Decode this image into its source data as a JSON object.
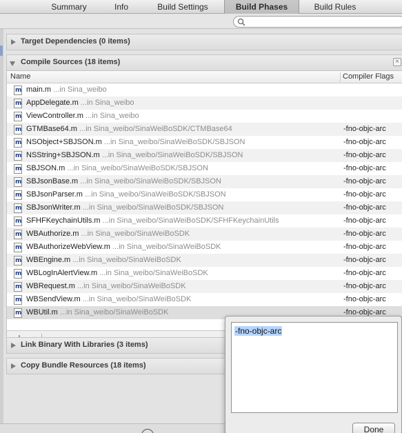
{
  "tabs": [
    {
      "label": "Summary"
    },
    {
      "label": "Info"
    },
    {
      "label": "Build Settings"
    },
    {
      "label": "Build Phases"
    },
    {
      "label": "Build Rules"
    }
  ],
  "active_tab": "Build Phases",
  "phases": {
    "target_dependencies": "Target Dependencies (0 items)",
    "compile_sources": "Compile Sources (18 items)",
    "link_binary": "Link Binary With Libraries (3 items)",
    "copy_bundle": "Copy Bundle Resources (18 items)"
  },
  "columns": {
    "name": "Name",
    "flags": "Compiler Flags"
  },
  "files": [
    {
      "name": "main.m",
      "path": " ...in Sina_weibo",
      "flag": ""
    },
    {
      "name": "AppDelegate.m",
      "path": " ...in Sina_weibo",
      "flag": ""
    },
    {
      "name": "ViewController.m",
      "path": " ...in Sina_weibo",
      "flag": ""
    },
    {
      "name": "GTMBase64.m",
      "path": " ...in Sina_weibo/SinaWeiBoSDK/CTMBase64",
      "flag": "-fno-objc-arc"
    },
    {
      "name": "NSObject+SBJSON.m",
      "path": " ...in Sina_weibo/SinaWeiBoSDK/SBJSON",
      "flag": "-fno-objc-arc"
    },
    {
      "name": "NSString+SBJSON.m",
      "path": " ...in Sina_weibo/SinaWeiBoSDK/SBJSON",
      "flag": "-fno-objc-arc"
    },
    {
      "name": "SBJSON.m",
      "path": " ...in Sina_weibo/SinaWeiBoSDK/SBJSON",
      "flag": "-fno-objc-arc"
    },
    {
      "name": "SBJsonBase.m",
      "path": " ...in Sina_weibo/SinaWeiBoSDK/SBJSON",
      "flag": "-fno-objc-arc"
    },
    {
      "name": "SBJsonParser.m",
      "path": " ...in Sina_weibo/SinaWeiBoSDK/SBJSON",
      "flag": "-fno-objc-arc"
    },
    {
      "name": "SBJsonWriter.m",
      "path": " ...in Sina_weibo/SinaWeiBoSDK/SBJSON",
      "flag": "-fno-objc-arc"
    },
    {
      "name": "SFHFKeychainUtils.m",
      "path": " ...in Sina_weibo/SinaWeiBoSDK/SFHFKeychainUtils",
      "flag": "-fno-objc-arc"
    },
    {
      "name": "WBAuthorize.m",
      "path": " ...in Sina_weibo/SinaWeiBoSDK",
      "flag": "-fno-objc-arc"
    },
    {
      "name": "WBAuthorizeWebView.m",
      "path": " ...in Sina_weibo/SinaWeiBoSDK",
      "flag": "-fno-objc-arc"
    },
    {
      "name": "WBEngine.m",
      "path": " ...in Sina_weibo/SinaWeiBoSDK",
      "flag": "-fno-objc-arc"
    },
    {
      "name": "WBLogInAlertView.m",
      "path": " ...in Sina_weibo/SinaWeiBoSDK",
      "flag": "-fno-objc-arc"
    },
    {
      "name": "WBRequest.m",
      "path": " ...in Sina_weibo/SinaWeiBoSDK",
      "flag": "-fno-objc-arc"
    },
    {
      "name": "WBSendView.m",
      "path": " ...in Sina_weibo/SinaWeiBoSDK",
      "flag": "-fno-objc-arc"
    },
    {
      "name": "WBUtil.m",
      "path": " ...in Sina_weibo/SinaWeiBoSDK",
      "flag": "-fno-objc-arc"
    }
  ],
  "selected_file": "WBUtil.m",
  "add_bar": {
    "add": "+",
    "remove": "−"
  },
  "editor": {
    "value": "-fno-objc-arc",
    "done_label": "Done"
  },
  "icons": {
    "file": "objc-source-file-icon",
    "search": "search-icon",
    "close": "close-icon"
  },
  "colors": {
    "selection": "#b5d5ff",
    "row_selected": "#dedede"
  }
}
